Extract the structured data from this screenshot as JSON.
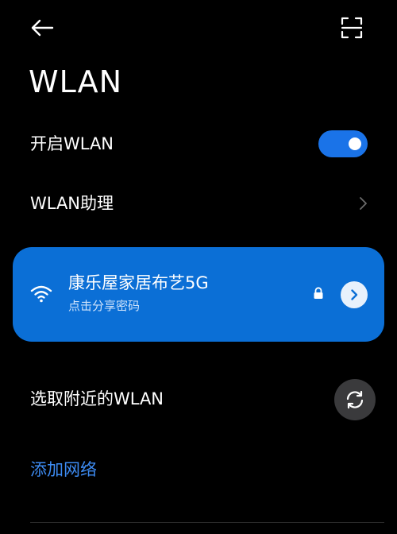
{
  "header": {
    "back_icon": "arrow-left-icon",
    "scan_icon": "scan-qr-icon",
    "title": "WLAN"
  },
  "wlan_toggle": {
    "label": "开启WLAN",
    "enabled": true,
    "accent_color": "#1a73e8"
  },
  "assistant": {
    "label": "WLAN助理",
    "icon": "chevron-right-icon"
  },
  "connected_network": {
    "ssid": "康乐屋家居布艺5G",
    "subtitle": "点击分享密码",
    "secured": true,
    "card_color": "#0b6fd6",
    "wifi_icon": "wifi-icon",
    "lock_icon": "lock-icon",
    "detail_icon": "chevron-right-icon"
  },
  "nearby": {
    "label": "选取附近的WLAN",
    "refresh_icon": "refresh-icon"
  },
  "add_network": {
    "label": "添加网络",
    "color": "#3d8bf2"
  }
}
